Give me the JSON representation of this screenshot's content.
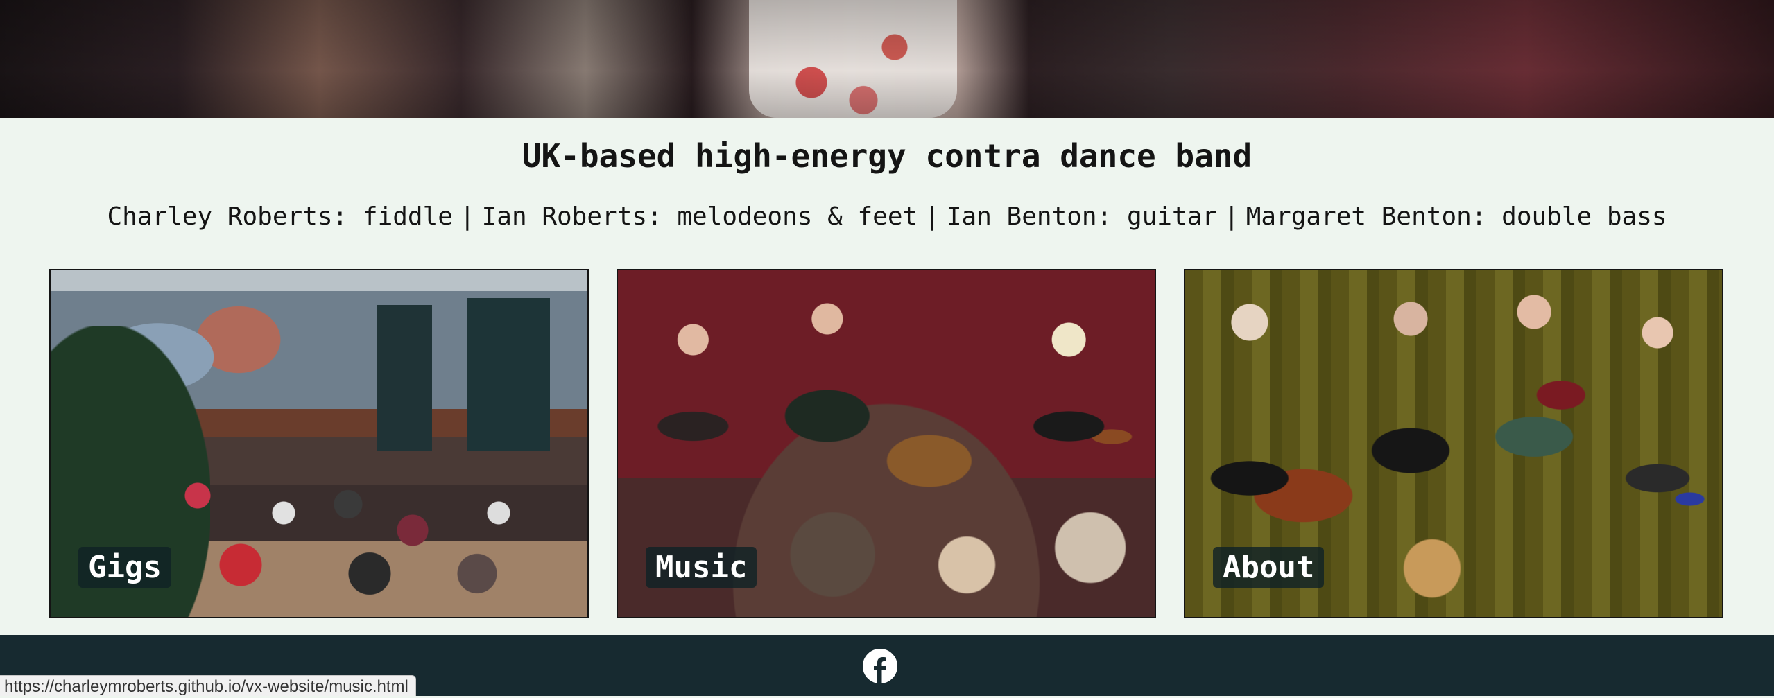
{
  "hero": {
    "image": "dancing-crowd-banner"
  },
  "headline": "UK-based high-energy contra dance band",
  "members": [
    "Charley Roberts: fiddle",
    "Ian Roberts: melodeons & feet",
    "Ian Benton: guitar",
    "Margaret Benton: double bass"
  ],
  "member_separator": "|",
  "cards": [
    {
      "label": "Gigs"
    },
    {
      "label": "Music"
    },
    {
      "label": "About"
    }
  ],
  "footer": {
    "icon": "facebook-icon"
  },
  "status_bar": {
    "url": "https://charleymroberts.github.io/vx-website/music.html"
  }
}
